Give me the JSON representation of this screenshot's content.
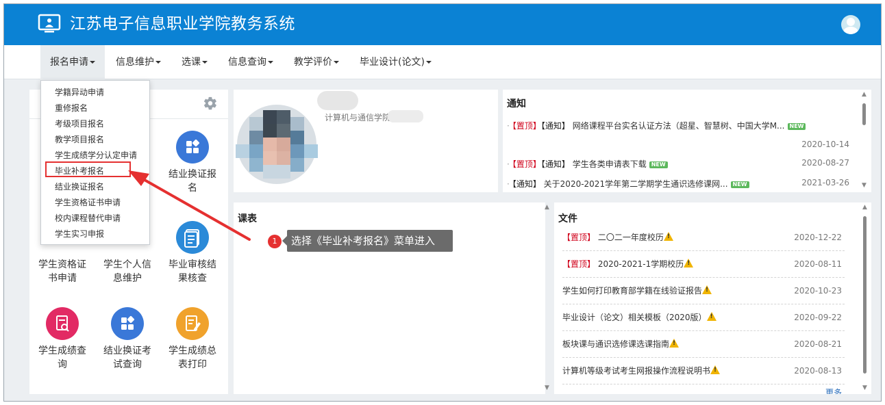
{
  "app": {
    "title": "江苏电子信息职业学院教务系统"
  },
  "nav": {
    "items": [
      {
        "label": "报名申请"
      },
      {
        "label": "信息维护"
      },
      {
        "label": "选课"
      },
      {
        "label": "信息查询"
      },
      {
        "label": "教学评价"
      },
      {
        "label": "毕业设计(论文)"
      }
    ]
  },
  "dropdown": {
    "items": [
      "学籍异动申请",
      "重修报名",
      "考级项目报名",
      "教学项目报名",
      "学生成绩学分认定申请",
      "毕业补考报名",
      "结业换证报名",
      "学生资格证书申请",
      "校内课程替代申请",
      "学生实习申报"
    ],
    "highlighted_index": 5
  },
  "tiles": [
    {
      "label_line1": "结业换证报",
      "label_line2": "名",
      "icon": "grid-icon",
      "color": "#3a78d8"
    },
    {
      "label_line1": "学生资格证",
      "label_line2": "书申请",
      "icon": "certificate-icon",
      "color": "#2b8ad8"
    },
    {
      "label_line1": "学生个人信",
      "label_line2": "息维护",
      "icon": "person-icon",
      "color": "#f0a22c"
    },
    {
      "label_line1": "毕业审核结",
      "label_line2": "果核查",
      "icon": "document-list-icon",
      "color": "#2b8ad8"
    },
    {
      "label_line1": "学生成绩查",
      "label_line2": "询",
      "icon": "report-search-icon",
      "color": "#e22a64"
    },
    {
      "label_line1": "结业换证考",
      "label_line2": "试查询",
      "icon": "grid-icon",
      "color": "#3a78d8"
    },
    {
      "label_line1": "学生成绩总",
      "label_line2": "表打印",
      "icon": "edit-document-icon",
      "color": "#f0a22c"
    }
  ],
  "profile": {
    "department": "计算机与通信学院"
  },
  "notices": {
    "title": "通知",
    "items": [
      {
        "top_tag": "【置顶】",
        "type_tag": "【通知】",
        "text": "网络课程平台实名认证方法（超星、智慧树、中国大学M...",
        "new": "NEW",
        "date": "2020-10-14"
      },
      {
        "top_tag": "【置顶】",
        "type_tag": "【通知】",
        "text": "学生各类申请表下载",
        "new": "NEW",
        "date": "2020-08-27"
      },
      {
        "top_tag": "",
        "type_tag": "【通知】",
        "text": "关于2020-2021学年第二学期学生通识选修课网...",
        "new": "NEW",
        "date": "2021-03-26"
      }
    ]
  },
  "schedule": {
    "title": "课表"
  },
  "files": {
    "title": "文件",
    "items": [
      {
        "top_tag": "【置顶】",
        "text": "二〇二一年度校历",
        "date": "2020-12-22"
      },
      {
        "top_tag": "【置顶】",
        "text": "2020-2021-1学期校历",
        "date": "2020-08-11"
      },
      {
        "top_tag": "",
        "text": "学生如何打印教育部学籍在线验证报告",
        "date": "2020-10-23"
      },
      {
        "top_tag": "",
        "text": "毕业设计（论文）相关模板（2020版）",
        "date": "2020-09-22"
      },
      {
        "top_tag": "",
        "text": "板块课与通识选修课选课指南",
        "date": "2020-08-21"
      },
      {
        "top_tag": "",
        "text": "计算机等级考试考生网报操作流程说明书",
        "date": "2020-08-13"
      }
    ],
    "more": "更多"
  },
  "annotation": {
    "step": "1",
    "text": "选择《毕业补考报名》菜单进入"
  },
  "colors": {
    "header": "#0b82d4",
    "highlight": "#e53030",
    "top_tag": "#d0021b"
  }
}
